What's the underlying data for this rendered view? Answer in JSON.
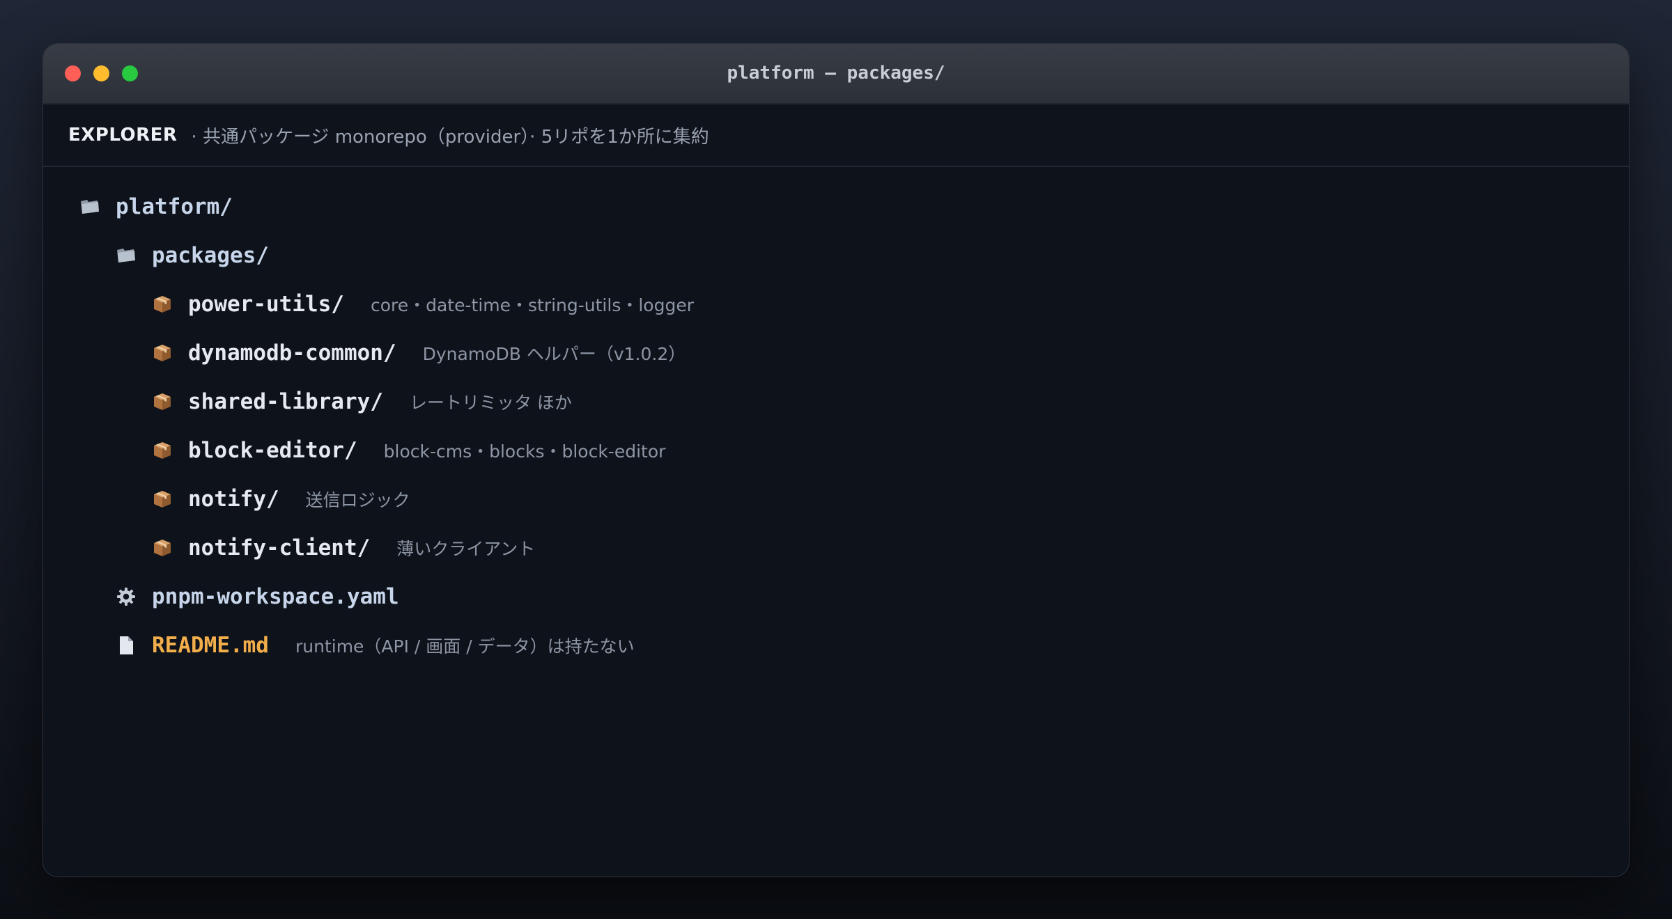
{
  "window": {
    "title": "platform — packages/"
  },
  "explorer": {
    "label": "EXPLORER",
    "description": "· 共通パッケージ monorepo（provider）· 5リポを1か所に集約"
  },
  "tree": {
    "root": {
      "name": "platform/",
      "icon": "folder-icon"
    },
    "packages_folder": {
      "name": "packages/",
      "icon": "folder-icon"
    },
    "packages": [
      {
        "name": "power-utils/",
        "desc": "core・date-time・string-utils・logger",
        "icon": "package-icon"
      },
      {
        "name": "dynamodb-common/",
        "desc": "DynamoDB ヘルパー（v1.0.2）",
        "icon": "package-icon"
      },
      {
        "name": "shared-library/",
        "desc": "レートリミッタ ほか",
        "icon": "package-icon"
      },
      {
        "name": "block-editor/",
        "desc": "block-cms・blocks・block-editor",
        "icon": "package-icon"
      },
      {
        "name": "notify/",
        "desc": "送信ロジック",
        "icon": "package-icon"
      },
      {
        "name": "notify-client/",
        "desc": "薄いクライアント",
        "icon": "package-icon"
      }
    ],
    "workspace_file": {
      "name": "pnpm-workspace.yaml",
      "icon": "gear-icon"
    },
    "readme": {
      "name": "README.md",
      "desc": "runtime（API / 画面 / データ）は持たない",
      "icon": "document-icon"
    }
  },
  "colors": {
    "readme_accent": "#f1ae4a",
    "close": "#ff5f57",
    "minimize": "#febc2e",
    "zoom": "#28c840"
  }
}
